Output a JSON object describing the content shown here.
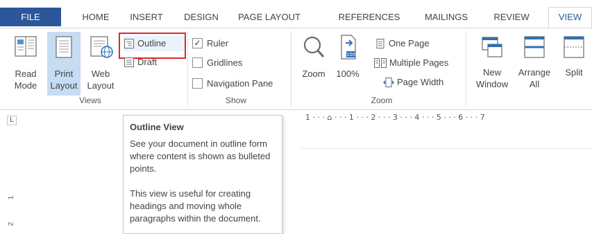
{
  "tabs": [
    {
      "id": "file",
      "label": "FILE"
    },
    {
      "id": "home",
      "label": "HOME"
    },
    {
      "id": "insert",
      "label": "INSERT"
    },
    {
      "id": "design",
      "label": "DESIGN"
    },
    {
      "id": "page_layout",
      "label": "PAGE LAYOUT"
    },
    {
      "id": "references",
      "label": "REFERENCES"
    },
    {
      "id": "mailings",
      "label": "MAILINGS"
    },
    {
      "id": "review",
      "label": "REVIEW"
    },
    {
      "id": "view",
      "label": "VIEW",
      "active": true
    }
  ],
  "views_group": {
    "label": "Views",
    "read_mode": {
      "line1": "Read",
      "line2": "Mode"
    },
    "print_layout": {
      "line1": "Print",
      "line2": "Layout",
      "selected": true
    },
    "web_layout": {
      "line1": "Web",
      "line2": "Layout"
    },
    "outline": "Outline",
    "draft": "Draft"
  },
  "show_group": {
    "label": "Show",
    "ruler": {
      "label": "Ruler",
      "checked": true,
      "mark": "✓"
    },
    "gridlines": {
      "label": "Gridlines",
      "checked": false
    },
    "navigation_pane": {
      "label": "Navigation Pane",
      "checked": false
    }
  },
  "zoom_group": {
    "label": "Zoom",
    "zoom": "Zoom",
    "hundred": "100%",
    "hundred_badge": "100",
    "one_page": "One Page",
    "multiple_pages": "Multiple Pages",
    "page_width": "Page Width"
  },
  "window_group": {
    "new_window": {
      "line1": "New",
      "line2": "Window"
    },
    "arrange_all": {
      "line1": "Arrange",
      "line2": "All"
    },
    "split": "Split"
  },
  "ruler": {
    "corner": "L",
    "h_ticks": "1 · · · ⌂ · · · 1 · · · 2 · · · 3 · · · 4 · · · 5 · · · 6 · · · 7",
    "v_numbers": [
      "2",
      "1"
    ]
  },
  "tooltip": {
    "title": "Outline View",
    "para1": "See your document in outline form where content is shown as bulleted points.",
    "para2": "This view is useful for creating headings and moving whole paragraphs within the document."
  },
  "colors": {
    "file_tab": "#2b579a",
    "active_tab_text": "#2b579a",
    "selected_button": "#c5dcf3",
    "highlight_border": "#e0252b"
  }
}
